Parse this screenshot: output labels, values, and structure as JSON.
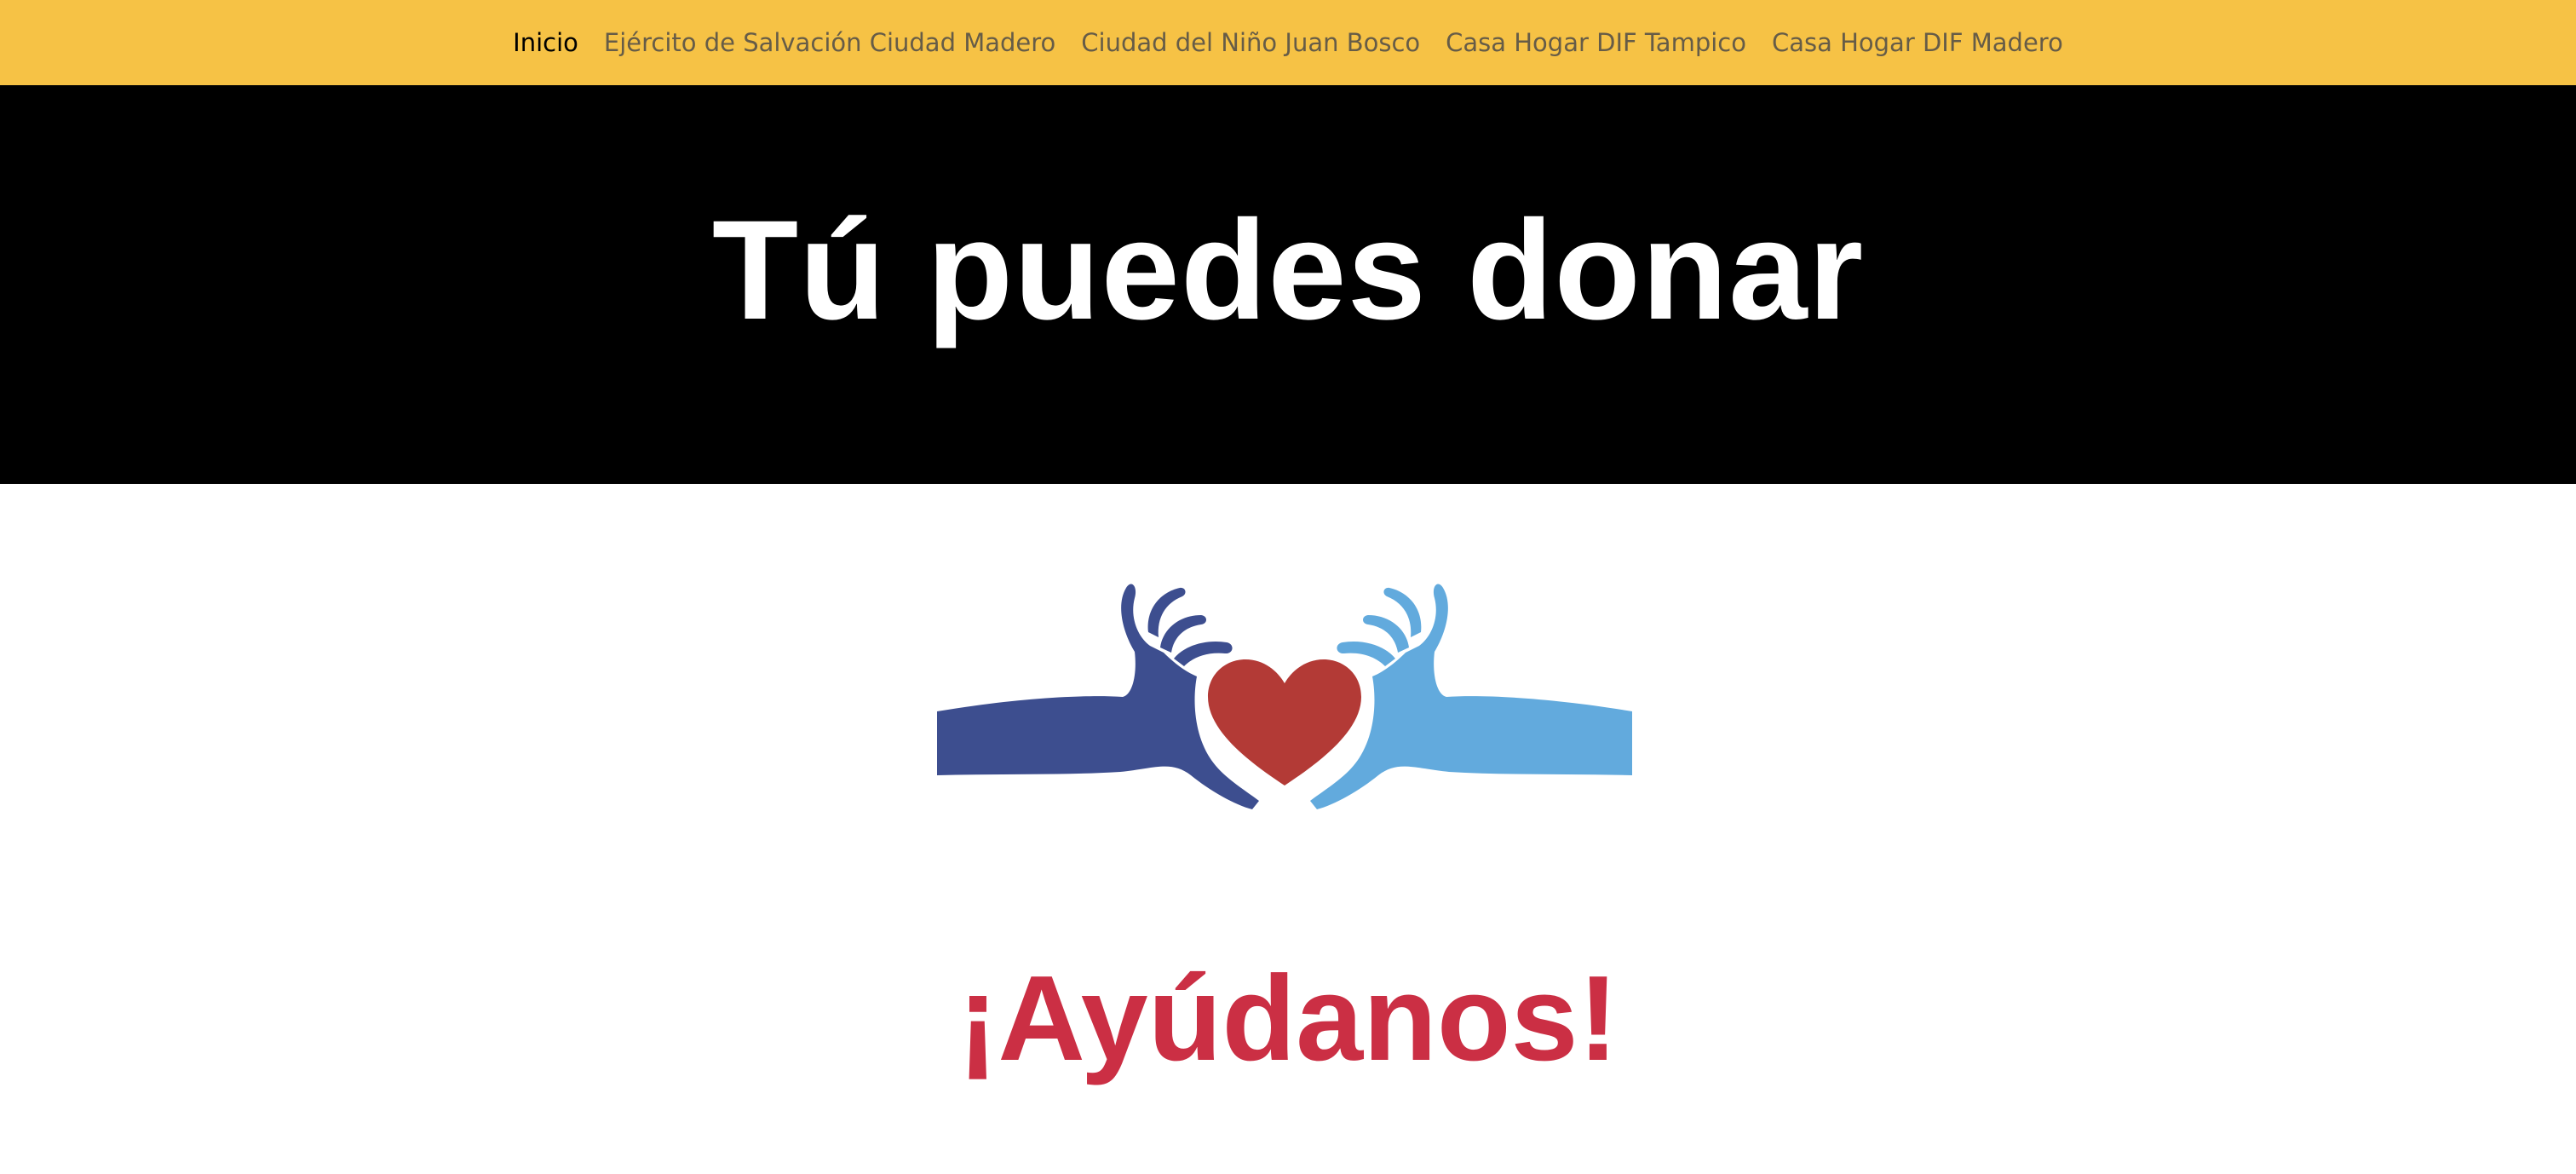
{
  "nav": {
    "items": [
      {
        "label": "Inicio",
        "active": true
      },
      {
        "label": "Ejército de Salvación Ciudad Madero",
        "active": false
      },
      {
        "label": "Ciudad del Niño Juan Bosco",
        "active": false
      },
      {
        "label": "Casa Hogar DIF Tampico",
        "active": false
      },
      {
        "label": "Casa Hogar DIF Madero",
        "active": false
      }
    ]
  },
  "hero": {
    "title": "Tú puedes donar"
  },
  "logo": {
    "icon": "hands-heart-icon"
  },
  "main": {
    "cta": "¡Ayúdanos!"
  },
  "colors": {
    "navbar": "#f6c245",
    "hero_bg": "#000000",
    "hero_text": "#ffffff",
    "cta_text": "#cb2f44",
    "left_hand": "#3d4e8f",
    "right_hand": "#62aadd",
    "heart": "#b33a36"
  }
}
